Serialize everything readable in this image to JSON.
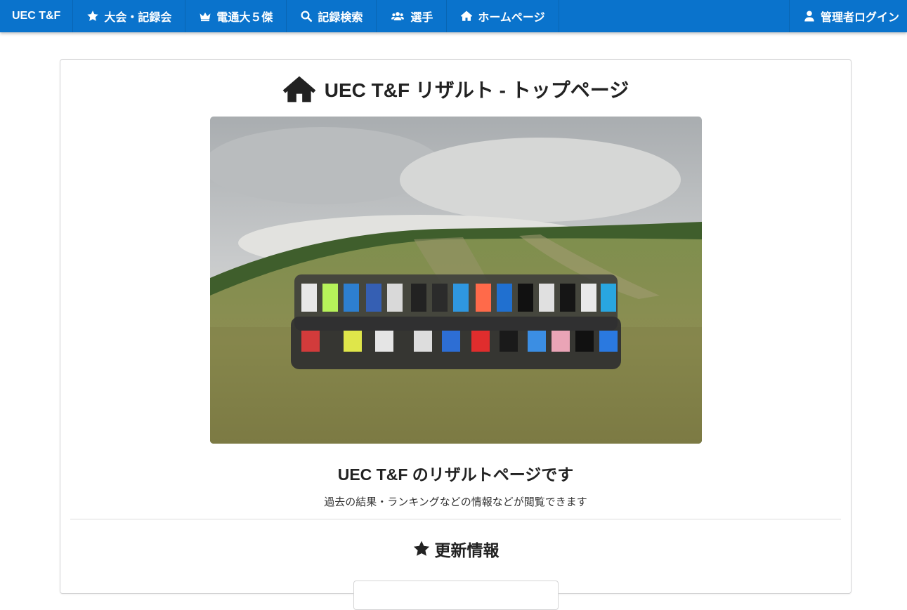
{
  "navbar": {
    "brand": "UEC T&F",
    "items": [
      {
        "label": "大会・記録会",
        "icon": "star-icon"
      },
      {
        "label": "電通大５傑",
        "icon": "crown-icon"
      },
      {
        "label": "記録検索",
        "icon": "search-icon"
      },
      {
        "label": "選手",
        "icon": "users-icon"
      },
      {
        "label": "ホームページ",
        "icon": "home-icon"
      }
    ],
    "admin_login": {
      "label": "管理者ログイン",
      "icon": "user-icon"
    },
    "color": "#0a73cc"
  },
  "main": {
    "page_title": "UEC T&F リザルト - トップページ",
    "title_icon": "home-icon",
    "hero_image": "team-group-photo",
    "subtitle": "UEC T&F のリザルトページです",
    "description": "過去の結果・ランキングなどの情報などが閲覧できます",
    "updates_title": "更新情報",
    "updates_icon": "star-icon"
  }
}
